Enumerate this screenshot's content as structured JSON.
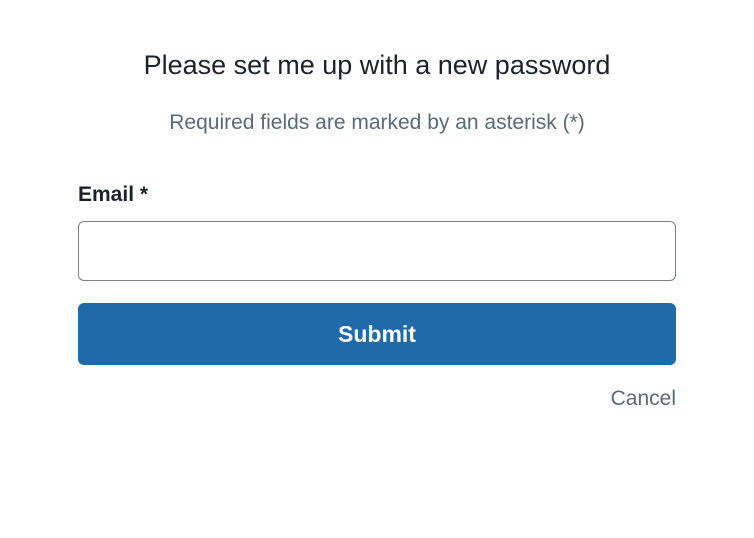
{
  "form": {
    "title": "Please set me up with a new password",
    "subtitle": "Required fields are marked by an asterisk (*)",
    "email": {
      "label": "Email *",
      "value": ""
    },
    "submit_label": "Submit",
    "cancel_label": "Cancel"
  }
}
